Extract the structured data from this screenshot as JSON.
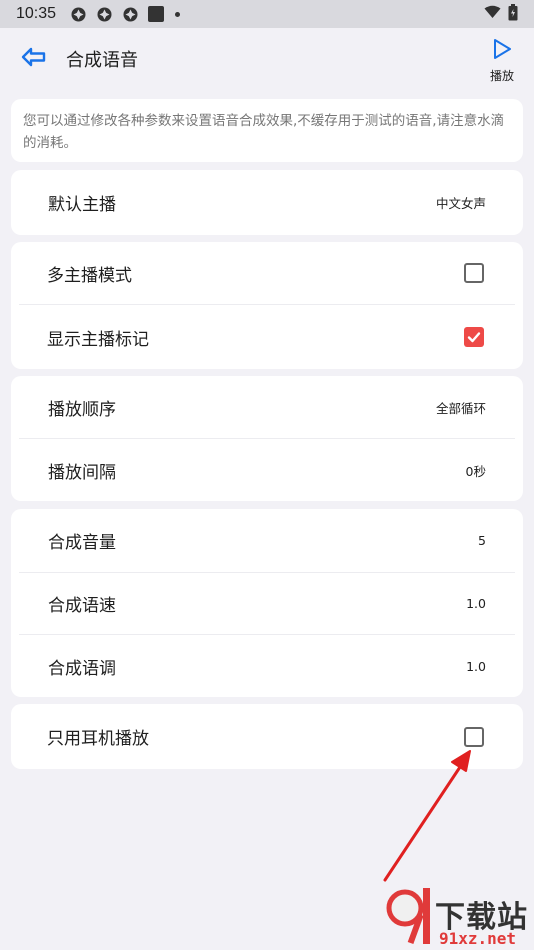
{
  "status_bar": {
    "time": "10:35"
  },
  "header": {
    "title": "合成语音",
    "play_label": "播放"
  },
  "notice": {
    "text": "您可以通过修改各种参数来设置语音合成效果,不缓存用于测试的语音,请注意水滴的消耗。"
  },
  "settings": {
    "default_speaker": {
      "label": "默认主播",
      "value": "中文女声"
    },
    "multi_speaker": {
      "label": "多主播模式",
      "checked": false
    },
    "show_speaker_mark": {
      "label": "显示主播标记",
      "checked": true
    },
    "play_order": {
      "label": "播放顺序",
      "value": "全部循环"
    },
    "play_interval": {
      "label": "播放间隔",
      "value": "0秒"
    },
    "volume": {
      "label": "合成音量",
      "value": "5"
    },
    "speed": {
      "label": "合成语速",
      "value": "1.0"
    },
    "pitch": {
      "label": "合成语调",
      "value": "1.0"
    },
    "earphone_only": {
      "label": "只用耳机播放",
      "checked": false
    }
  },
  "watermark": {
    "text": "下载站",
    "domain": "91xz.net"
  },
  "colors": {
    "accent_blue": "#1a73e8",
    "check_red": "#ee4a47",
    "arrow_red": "#e02020",
    "background": "#f2f1f6"
  },
  "icons": [
    "status-notification-icon",
    "wifi-icon",
    "battery-icon",
    "back-arrow-icon",
    "play-icon",
    "check-icon"
  ]
}
